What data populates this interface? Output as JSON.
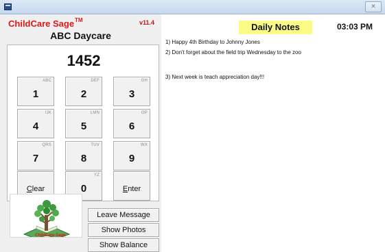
{
  "window": {
    "close_glyph": "✕"
  },
  "brand": {
    "name": "ChildCare Sage",
    "tm": "TM",
    "version": "v11.4"
  },
  "center_name": "ABC Daycare",
  "keypad": {
    "display": "1452",
    "keys": [
      {
        "num": "1",
        "letters": "ABC"
      },
      {
        "num": "2",
        "letters": "DEF"
      },
      {
        "num": "3",
        "letters": "GH"
      },
      {
        "num": "4",
        "letters": "IJK"
      },
      {
        "num": "5",
        "letters": "LMN"
      },
      {
        "num": "6",
        "letters": "OP"
      },
      {
        "num": "7",
        "letters": "QRS"
      },
      {
        "num": "8",
        "letters": "TUV"
      },
      {
        "num": "9",
        "letters": "WX"
      },
      {
        "num": "0",
        "letters": "YZ"
      }
    ],
    "clear_label": "Clear",
    "enter_label": "Enter"
  },
  "logo": {
    "text": "ChildCare Sage"
  },
  "actions": {
    "leave_message": "Leave Message",
    "show_photos": "Show Photos",
    "show_balance": "Show Balance"
  },
  "notes": {
    "title": "Daily Notes",
    "time": "03:03 PM",
    "lines": [
      "1) Happy 4th Birthday to Johnny Jones",
      "2) Don't forget about the field trip Wednesday to the zoo",
      "3) Next week is teach appreciation day!!!"
    ]
  },
  "colors": {
    "brand_red": "#e01616",
    "notes_highlight": "#fbfb86",
    "panel_bg": "#f0f0f0"
  }
}
